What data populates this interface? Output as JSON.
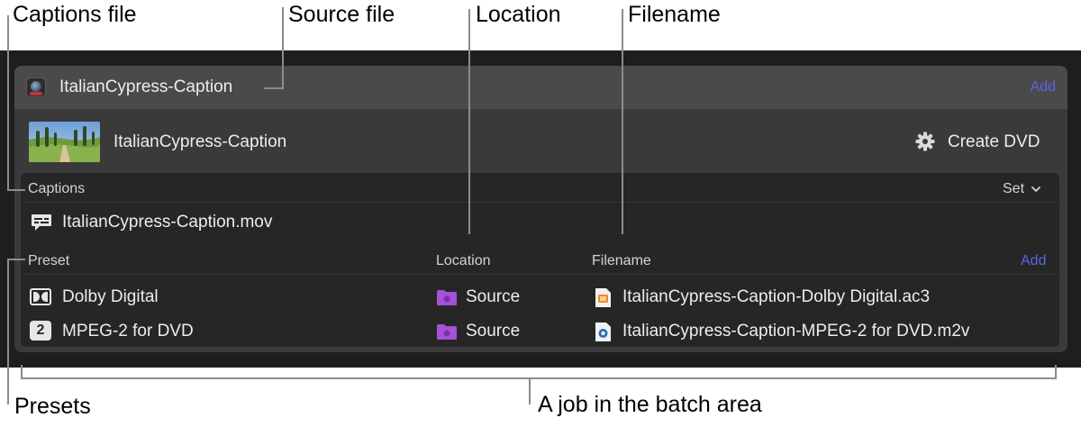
{
  "callouts": {
    "captions_file": "Captions file",
    "source_file": "Source file",
    "location": "Location",
    "filename": "Filename",
    "presets": "Presets",
    "job": "A job in the batch area"
  },
  "source": {
    "name": "ItalianCypress-Caption",
    "add_label": "Add"
  },
  "job": {
    "name": "ItalianCypress-Caption",
    "action_label": "Create DVD",
    "captions": {
      "header": "Captions",
      "set_label": "Set",
      "file": "ItalianCypress-Caption.mov"
    },
    "presets_table": {
      "col_preset": "Preset",
      "col_location": "Location",
      "col_filename": "Filename",
      "add_label": "Add",
      "rows": [
        {
          "preset": "Dolby Digital",
          "icon": "dolby-icon",
          "location": "Source",
          "filename": "ItalianCypress-Caption-Dolby Digital.ac3"
        },
        {
          "preset": "MPEG-2 for DVD",
          "icon": "number-2-icon",
          "badge": "2",
          "location": "Source",
          "filename": "ItalianCypress-Caption-MPEG-2 for DVD.m2v"
        }
      ]
    }
  },
  "colors": {
    "accent": "#5b63e8",
    "folder": "#a651d6",
    "window_bg": "#1e1e1e"
  }
}
